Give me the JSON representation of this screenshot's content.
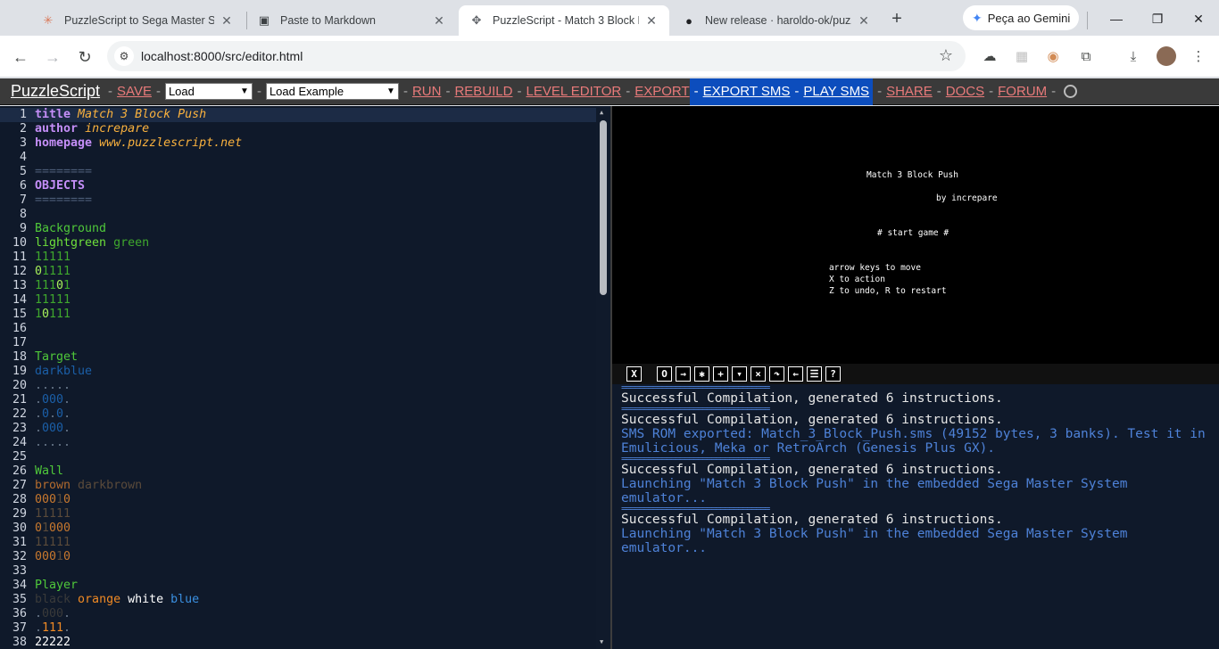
{
  "browser": {
    "tabs": [
      {
        "title": "PuzzleScript to Sega Master Sys",
        "icon": "claude-icon",
        "active": false
      },
      {
        "title": "Paste to Markdown",
        "icon": "markdown-icon",
        "active": false
      },
      {
        "title": "PuzzleScript - Match 3 Block Pu",
        "icon": "puzzlescript-icon",
        "active": true
      },
      {
        "title": "New release · haroldo-ok/puzzl",
        "icon": "github-icon",
        "active": false
      }
    ],
    "new_tab": "+",
    "gemini_label": "Peça ao Gemini",
    "url": "localhost:8000/src/editor.html"
  },
  "header": {
    "logo": "PuzzleScript",
    "save": "SAVE",
    "load_select": "Load",
    "load_example_select": "Load Example",
    "run": "RUN",
    "rebuild": "REBUILD",
    "level_editor": "LEVEL EDITOR",
    "export": "EXPORT",
    "export_sms": "EXPORT SMS",
    "play_sms": "PLAY SMS",
    "share": "SHARE",
    "docs": "DOCS",
    "forum": "FORUM",
    "sep": "-"
  },
  "editor": {
    "lines": [
      {
        "n": "1",
        "parts": [
          [
            "title",
            "kw"
          ],
          [
            " ",
            ""
          ],
          [
            "Match 3 Block Push",
            "meta"
          ]
        ]
      },
      {
        "n": "2",
        "parts": [
          [
            "author",
            "kw"
          ],
          [
            " ",
            ""
          ],
          [
            "increpare",
            "meta"
          ]
        ]
      },
      {
        "n": "3",
        "parts": [
          [
            "homepage",
            "kw"
          ],
          [
            " ",
            ""
          ],
          [
            "www.puzzlescript.net",
            "meta"
          ]
        ]
      },
      {
        "n": "4",
        "parts": []
      },
      {
        "n": "5",
        "parts": [
          [
            "========",
            "sep"
          ]
        ]
      },
      {
        "n": "6",
        "parts": [
          [
            "OBJECTS",
            "head"
          ]
        ]
      },
      {
        "n": "7",
        "parts": [
          [
            "========",
            "sep"
          ]
        ]
      },
      {
        "n": "8",
        "parts": []
      },
      {
        "n": "9",
        "parts": [
          [
            "Background",
            "name"
          ]
        ]
      },
      {
        "n": "10",
        "parts": [
          [
            "lightgreen",
            "#6ee03b"
          ],
          [
            " ",
            ""
          ],
          [
            "green",
            "#3fa82d"
          ]
        ]
      },
      {
        "n": "11",
        "parts": [
          [
            "11111",
            "#3fa82d"
          ]
        ]
      },
      {
        "n": "12",
        "parts": [
          [
            "0",
            "#a6f05a"
          ],
          [
            "1111",
            "#3fa82d"
          ]
        ]
      },
      {
        "n": "13",
        "parts": [
          [
            "111",
            "#3fa82d"
          ],
          [
            "0",
            "#a6f05a"
          ],
          [
            "1",
            "#3fa82d"
          ]
        ]
      },
      {
        "n": "14",
        "parts": [
          [
            "11111",
            "#3fa82d"
          ]
        ]
      },
      {
        "n": "15",
        "parts": [
          [
            "1",
            "#3fa82d"
          ],
          [
            "0",
            "#a6f05a"
          ],
          [
            "111",
            "#3fa82d"
          ]
        ]
      },
      {
        "n": "16",
        "parts": []
      },
      {
        "n": "17",
        "parts": []
      },
      {
        "n": "18",
        "parts": [
          [
            "Target",
            "name"
          ]
        ]
      },
      {
        "n": "19",
        "parts": [
          [
            "darkblue",
            "#1b5fa8"
          ]
        ]
      },
      {
        "n": "20",
        "parts": [
          [
            ".....",
            "grey"
          ]
        ]
      },
      {
        "n": "21",
        "parts": [
          [
            ".",
            "grey"
          ],
          [
            "000",
            "#1b5fa8"
          ],
          [
            ".",
            "grey"
          ]
        ]
      },
      {
        "n": "22",
        "parts": [
          [
            ".",
            "grey"
          ],
          [
            "0",
            "#1b5fa8"
          ],
          [
            ".",
            "grey"
          ],
          [
            "0",
            "#1b5fa8"
          ],
          [
            ".",
            "grey"
          ]
        ]
      },
      {
        "n": "23",
        "parts": [
          [
            ".",
            "grey"
          ],
          [
            "000",
            "#1b5fa8"
          ],
          [
            ".",
            "grey"
          ]
        ]
      },
      {
        "n": "24",
        "parts": [
          [
            ".....",
            "grey"
          ]
        ]
      },
      {
        "n": "25",
        "parts": []
      },
      {
        "n": "26",
        "parts": [
          [
            "Wall",
            "name"
          ]
        ]
      },
      {
        "n": "27",
        "parts": [
          [
            "brown",
            "#b36b2e"
          ],
          [
            " ",
            ""
          ],
          [
            "darkbrown",
            "#5a4a3a"
          ]
        ]
      },
      {
        "n": "28",
        "parts": [
          [
            "000",
            "#c8782e"
          ],
          [
            "1",
            "#5a4a3a"
          ],
          [
            "0",
            "#c8782e"
          ]
        ]
      },
      {
        "n": "29",
        "parts": [
          [
            "11111",
            "#5a4a3a"
          ]
        ]
      },
      {
        "n": "30",
        "parts": [
          [
            "0",
            "#c8782e"
          ],
          [
            "1",
            "#5a4a3a"
          ],
          [
            "000",
            "#c8782e"
          ]
        ]
      },
      {
        "n": "31",
        "parts": [
          [
            "11111",
            "#5a4a3a"
          ]
        ]
      },
      {
        "n": "32",
        "parts": [
          [
            "000",
            "#c8782e"
          ],
          [
            "1",
            "#5a4a3a"
          ],
          [
            "0",
            "#c8782e"
          ]
        ]
      },
      {
        "n": "33",
        "parts": []
      },
      {
        "n": "34",
        "parts": [
          [
            "Player",
            "name"
          ]
        ]
      },
      {
        "n": "35",
        "parts": [
          [
            "black",
            "#3a3a3a"
          ],
          [
            " ",
            ""
          ],
          [
            "orange",
            "#f08a24"
          ],
          [
            " ",
            ""
          ],
          [
            "white",
            "#ffffff"
          ],
          [
            " ",
            ""
          ],
          [
            "blue",
            "#3a8fe0"
          ]
        ]
      },
      {
        "n": "36",
        "parts": [
          [
            ".",
            "grey"
          ],
          [
            "000",
            "#3a3a3a"
          ],
          [
            ".",
            "grey"
          ]
        ]
      },
      {
        "n": "37",
        "parts": [
          [
            ".",
            "grey"
          ],
          [
            "111",
            "#f08a24"
          ],
          [
            ".",
            "grey"
          ]
        ]
      },
      {
        "n": "38",
        "parts": [
          [
            "22222",
            "#ffffff"
          ]
        ]
      }
    ]
  },
  "game": {
    "title": "Match 3 Block Push",
    "author": "by increpare",
    "start": "# start game #",
    "instr1": "arrow keys to move",
    "instr2": "X to action",
    "instr3": "Z to undo, R to restart"
  },
  "debug_buttons": [
    "X",
    "O",
    "→",
    "✱",
    "+",
    "▾",
    "×",
    "↷",
    "←",
    "☰",
    "?"
  ],
  "console": {
    "rule": "=================================",
    "messages": [
      {
        "type": "rule"
      },
      {
        "type": "ok",
        "text": "Successful Compilation, generated 6 instructions."
      },
      {
        "type": "rule"
      },
      {
        "type": "ok",
        "text": "Successful Compilation, generated 6 instructions."
      },
      {
        "type": "info",
        "text": "SMS ROM exported: Match_3_Block_Push.sms (49152 bytes, 3 banks). Test it in Emulicious, Meka or RetroArch (Genesis Plus GX)."
      },
      {
        "type": "rule"
      },
      {
        "type": "ok",
        "text": "Successful Compilation, generated 6 instructions."
      },
      {
        "type": "info",
        "text": "Launching \"Match 3 Block Push\" in the embedded Sega Master System emulator..."
      },
      {
        "type": "rule"
      },
      {
        "type": "ok",
        "text": "Successful Compilation, generated 6 instructions."
      },
      {
        "type": "info",
        "text": "Launching \"Match 3 Block Push\" in the embedded Sega Master System emulator..."
      }
    ]
  }
}
